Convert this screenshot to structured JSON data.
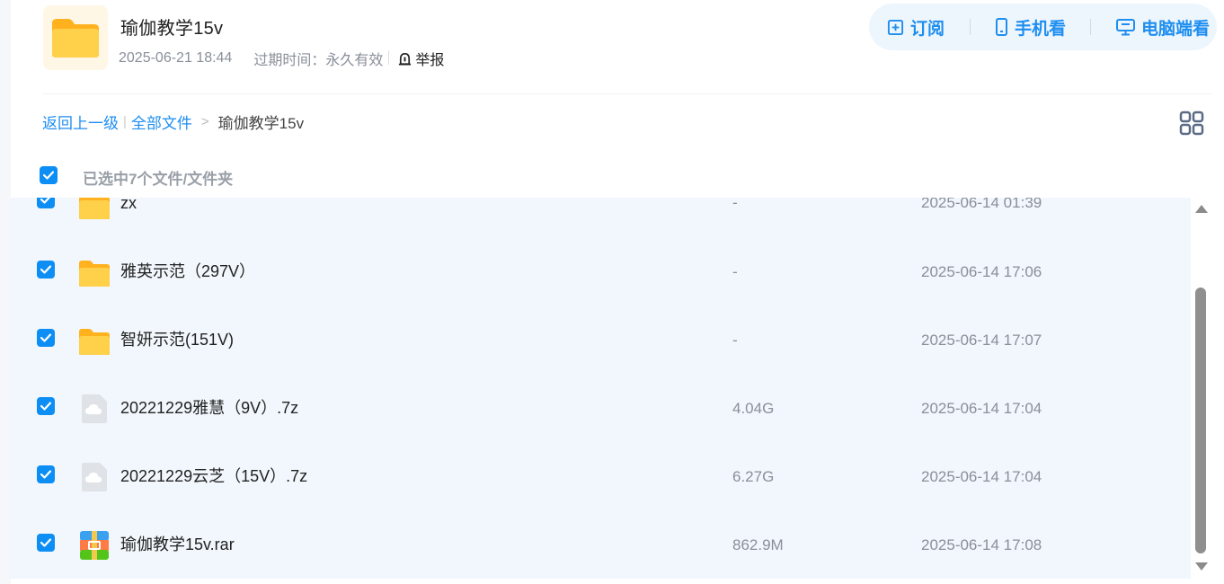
{
  "share": {
    "title": "瑜伽教学15v",
    "created": "2025-06-21 18:44",
    "expiry_label": "过期时间：",
    "expiry_value": "永久有效",
    "report_label": "举报"
  },
  "actions": {
    "subscribe": "订阅",
    "mobile": "手机看",
    "pc": "电脑端看"
  },
  "breadcrumb": {
    "back": "返回上一级",
    "all_files": "全部文件",
    "current": "瑜伽教学15v"
  },
  "selection": {
    "label": "已选中7个文件/文件夹"
  },
  "files": [
    {
      "name": "zx",
      "size": "-",
      "date": "2025-06-14 01:39",
      "icon": "folder-icon"
    },
    {
      "name": "雅英示范（297V）",
      "size": "-",
      "date": "2025-06-14 17:06",
      "icon": "folder-icon"
    },
    {
      "name": "智妍示范(151V)",
      "size": "-",
      "date": "2025-06-14 17:07",
      "icon": "folder-icon"
    },
    {
      "name": "20221229雅慧（9V）.7z",
      "size": "4.04G",
      "date": "2025-06-14 17:04",
      "icon": "cloud-file-icon"
    },
    {
      "name": "20221229云芝（15V）.7z",
      "size": "6.27G",
      "date": "2025-06-14 17:04",
      "icon": "cloud-file-icon"
    },
    {
      "name": "瑜伽教学15v.rar",
      "size": "862.9M",
      "date": "2025-06-14 17:08",
      "icon": "archive-icon"
    }
  ],
  "colors": {
    "accent": "#1e8ef0",
    "checkbox": "#0d8ef5",
    "list_bg": "#f1f7fc",
    "folder": "#ffc53d"
  }
}
